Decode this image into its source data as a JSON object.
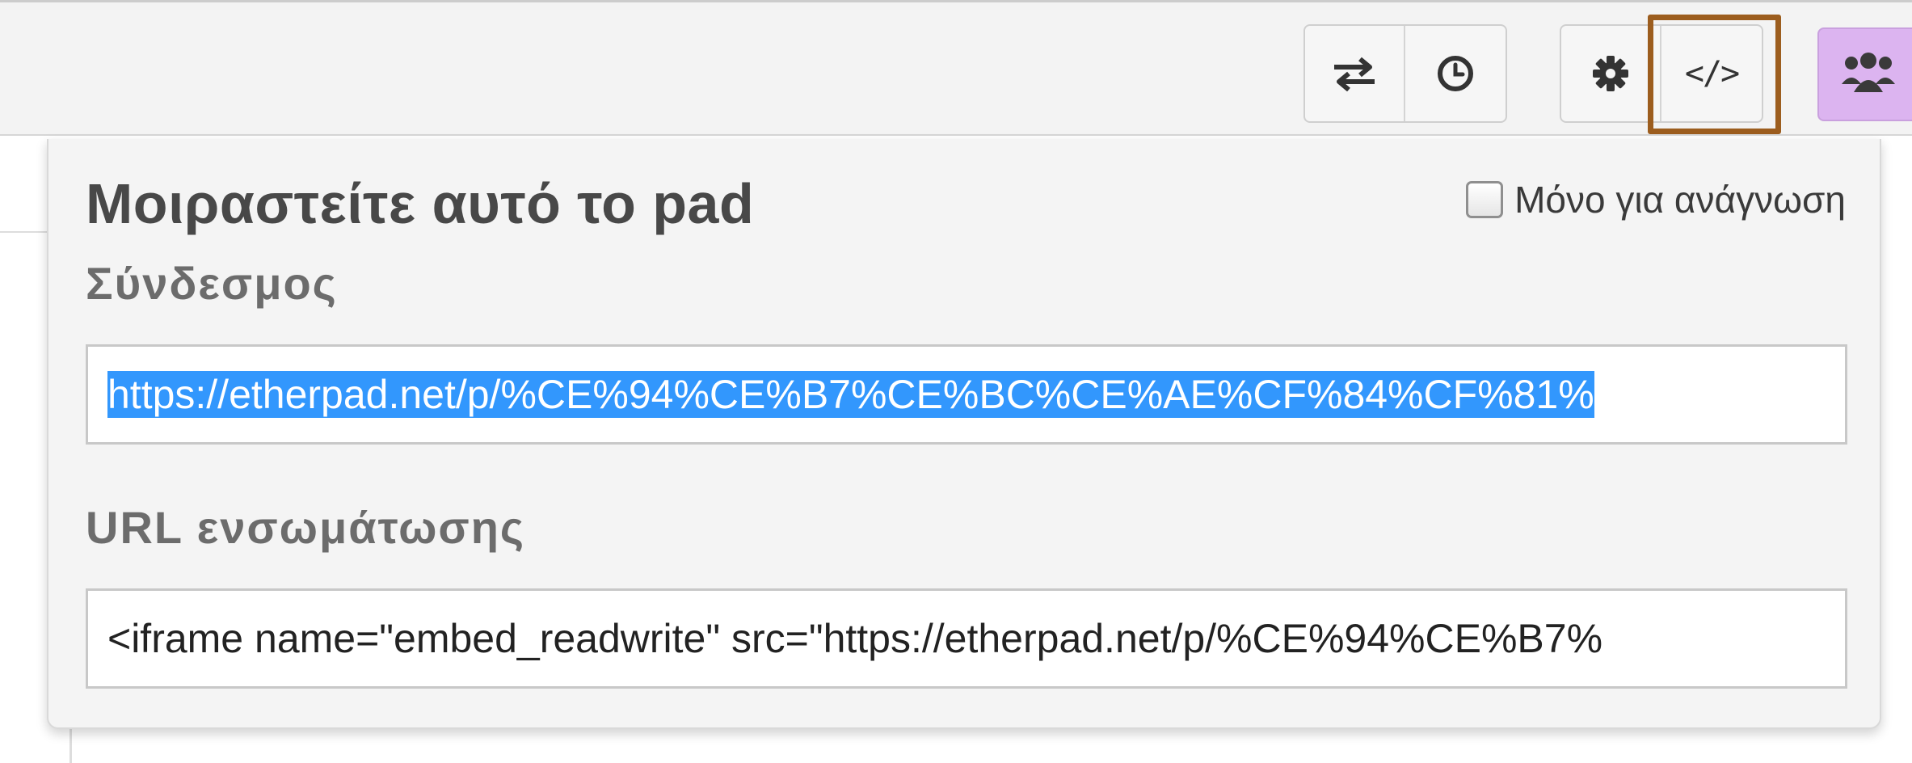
{
  "toolbar": {
    "buttons": [
      {
        "name": "import-export",
        "glyph": "⇄"
      },
      {
        "name": "timeslider",
        "glyph": "◷"
      },
      {
        "name": "settings",
        "glyph": "⚙"
      },
      {
        "name": "embed",
        "glyph": "</>"
      },
      {
        "name": "users",
        "glyph": "👥"
      }
    ],
    "highlight_color": "#9c5d1e",
    "users_button_color": "#dcb4f0"
  },
  "share_popup": {
    "title": "Μοιραστείτε αυτό το pad",
    "readonly_label": "Μόνο για ανάγνωση",
    "readonly_checked": false,
    "link_label": "Σύνδεσμος",
    "link_value": "https://etherpad.net/p/%CE%94%CE%B7%CE%BC%CE%AE%CF%84%CF%81%",
    "embed_label": "URL ενσωμάτωσης",
    "embed_value": "<iframe name=\"embed_readwrite\" src=\"https://etherpad.net/p/%CE%94%CE%B7%",
    "selection_color": "#3297fd"
  }
}
